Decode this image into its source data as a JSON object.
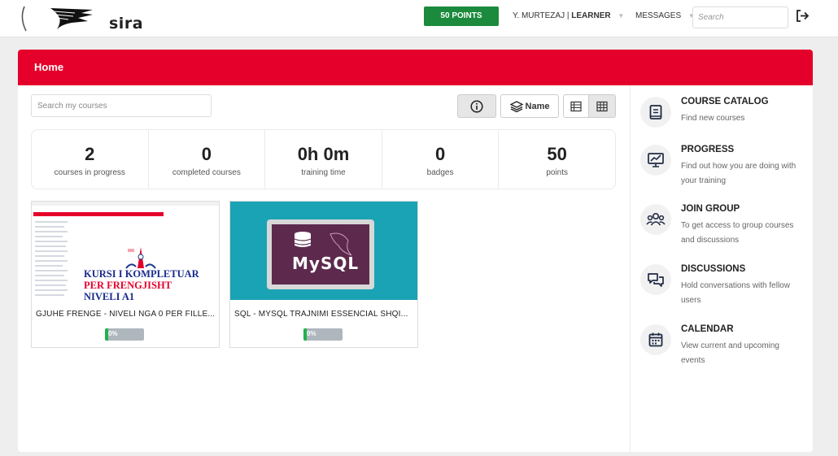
{
  "header": {
    "logo_text": "sira",
    "points_label": "50 POINTS",
    "user_name": "Y. MURTEZAJ",
    "user_role": "LEARNER",
    "messages_label": "MESSAGES",
    "search_placeholder": "Search",
    "logout_icon": "logout-icon"
  },
  "page": {
    "title": "Home",
    "course_search_placeholder": "Search my courses",
    "sort_label": "Name"
  },
  "stats": [
    {
      "value": "2",
      "label": "courses in progress"
    },
    {
      "value": "0",
      "label": "completed courses"
    },
    {
      "value": "0h 0m",
      "label": "training time"
    },
    {
      "value": "0",
      "label": "badges"
    },
    {
      "value": "50",
      "label": "points"
    }
  ],
  "courses": [
    {
      "title": "GJUHE FRENGE - NIVELI NGA 0 PER FILLE...",
      "progress_label": "0%",
      "progress": 0,
      "thumb_lines": [
        "KURSI I KOMPLETUAR",
        "PER FRENGJISHT",
        "NIVELI A1"
      ]
    },
    {
      "title": "SQL - MYSQL TRAJNIMI ESSENCIAL SHQI...",
      "progress_label": "0%",
      "progress": 0,
      "thumb_text": "MySQL"
    }
  ],
  "sidebar": [
    {
      "title": "COURSE CATALOG",
      "desc": "Find new courses",
      "icon": "book-icon"
    },
    {
      "title": "PROGRESS",
      "desc": "Find out how you are doing with your training",
      "icon": "chart-icon"
    },
    {
      "title": "JOIN GROUP",
      "desc": "To get access to group courses and discussions",
      "icon": "group-icon"
    },
    {
      "title": "DISCUSSIONS",
      "desc": "Hold conversations with fellow users",
      "icon": "chat-icon"
    },
    {
      "title": "CALENDAR",
      "desc": "View current and upcoming events",
      "icon": "calendar-icon"
    }
  ],
  "colors": {
    "brand_red": "#e5002b",
    "points_green": "#1b8a3c",
    "progress_green": "#22b14c",
    "mysql_teal": "#1aa3b4",
    "mysql_purple": "#5d2a4e"
  }
}
